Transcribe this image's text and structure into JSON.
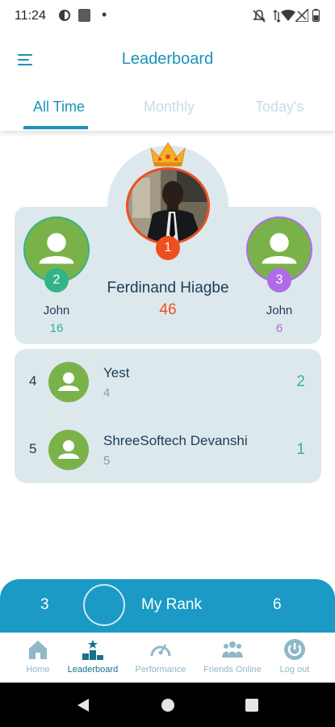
{
  "status_bar": {
    "time": "11:24",
    "dot": "•"
  },
  "app_bar": {
    "title": "Leaderboard",
    "tabs": [
      {
        "label": "All Time",
        "active": true
      },
      {
        "label": "Monthly",
        "active": false
      },
      {
        "label": "Today's",
        "active": false
      }
    ]
  },
  "podium": {
    "first": {
      "name": "Ferdinand Hiagbe",
      "score": "46",
      "rank": "1",
      "color": "#ee4f1f"
    },
    "second": {
      "name": "John",
      "score": "16",
      "rank": "2",
      "color": "#32b388"
    },
    "third": {
      "name": "John",
      "score": "6",
      "rank": "3",
      "color": "#b06ce8"
    }
  },
  "list": [
    {
      "rank": "4",
      "name": "Yest",
      "sub": "4",
      "score": "2"
    },
    {
      "rank": "5",
      "name": "ShreeSoftech Devanshi",
      "sub": "5",
      "score": "1"
    }
  ],
  "my_rank": {
    "position": "3",
    "label": "My Rank",
    "score": "6"
  },
  "bottom_nav": [
    {
      "label": "Home",
      "icon": "home-icon"
    },
    {
      "label": "Leaderboard",
      "icon": "leaderboard-icon",
      "active": true
    },
    {
      "label": "Performance",
      "icon": "performance-icon"
    },
    {
      "label": "Friends Online",
      "icon": "friends-icon"
    },
    {
      "label": "Log out",
      "icon": "power-icon"
    }
  ],
  "colors": {
    "accent": "#1a93b8",
    "avatar_green": "#7ab24a",
    "card_bg": "#dde8ed",
    "score_green": "#32b388"
  }
}
